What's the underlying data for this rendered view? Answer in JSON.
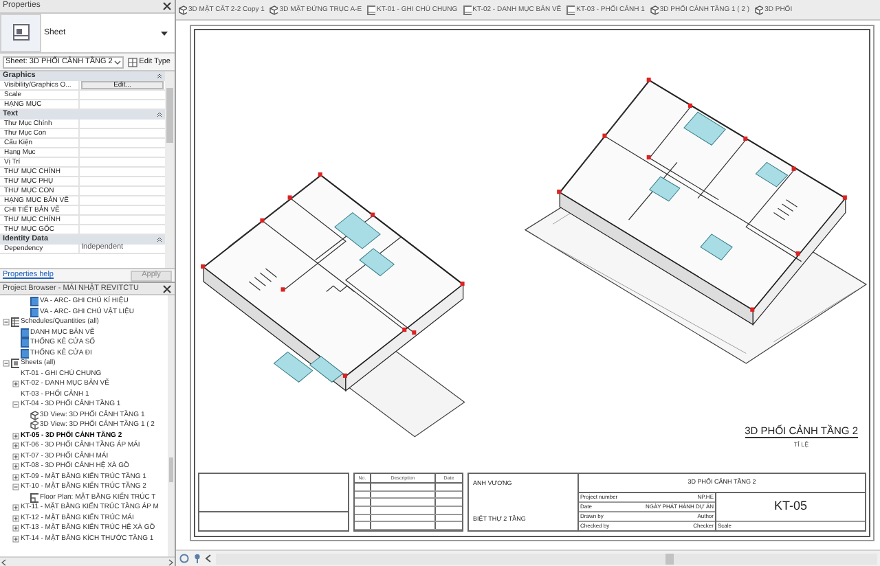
{
  "properties": {
    "title": "Properties",
    "type_name": "Sheet",
    "instance_selector": "Sheet: 3D PHỐI CẢNH TẦNG 2",
    "edit_type_button": "Edit Type",
    "groups": [
      {
        "name": "Graphics",
        "rows": [
          {
            "label": "Visibility/Graphics O...",
            "kind": "button",
            "value": "Edit..."
          },
          {
            "label": "Scale",
            "kind": "text"
          },
          {
            "label": "HẠNG MỤC",
            "kind": "text"
          }
        ]
      },
      {
        "name": "Text",
        "rows": [
          {
            "label": "Thư Mục Chính",
            "kind": "text"
          },
          {
            "label": "Thư Mục Con",
            "kind": "text"
          },
          {
            "label": "Cấu Kiện",
            "kind": "text"
          },
          {
            "label": "Hạng Mục",
            "kind": "text"
          },
          {
            "label": "Vị Trí",
            "kind": "text"
          },
          {
            "label": "THƯ MỤC CHÍNH",
            "kind": "text"
          },
          {
            "label": "THƯ MỤC PHỤ",
            "kind": "text"
          },
          {
            "label": "THƯ MỤC CON",
            "kind": "text"
          },
          {
            "label": "HẠNG MỤC BẢN VẼ",
            "kind": "text"
          },
          {
            "label": "CHI TIẾT BẢN VẼ",
            "kind": "text"
          },
          {
            "label": "THƯ MỤC CHÍNH",
            "kind": "text"
          },
          {
            "label": "THƯ MỤC GỐC",
            "kind": "text"
          }
        ]
      },
      {
        "name": "Identity Data",
        "rows": [
          {
            "label": "Dependency",
            "kind": "text",
            "value": "Independent"
          }
        ]
      }
    ],
    "help_link": "Properties help",
    "apply_button": {
      "label": "Apply",
      "disabled": true
    }
  },
  "project_browser": {
    "title": "Project Browser - MÁI NHẬT REVITCTU",
    "tree": [
      {
        "label": "VA - ARC- GHI CHÚ KÍ HIỆU",
        "kind": "legend",
        "selected": false
      },
      {
        "label": "VA - ARC- GHI CHÚ VẬT LIỆU",
        "kind": "legend",
        "selected": false
      },
      {
        "label": "Schedules/Quantities (all)",
        "kind": "schedules",
        "expanded": true,
        "selected": false,
        "children": [
          {
            "label": "DANH MỤC BẢN VẼ",
            "kind": "schedule",
            "selected": false
          },
          {
            "label": "THỐNG KÊ CỬA SỔ",
            "kind": "schedule",
            "selected": false
          },
          {
            "label": "THỐNG KÊ CỬA ĐI",
            "kind": "schedule",
            "selected": false
          }
        ]
      },
      {
        "label": "Sheets (all)",
        "kind": "sheets",
        "expanded": true,
        "selected": false,
        "children": [
          {
            "label": "KT-01 - GHI CHÚ CHUNG",
            "kind": "sheet",
            "selected": false
          },
          {
            "label": "KT-02 - DANH MỤC BẢN VẼ",
            "kind": "sheet",
            "expanded": false,
            "selected": false
          },
          {
            "label": "KT-03 - PHỐI CẢNH 1",
            "kind": "sheet",
            "selected": false
          },
          {
            "label": "KT-04 - 3D PHỐI CẢNH TẦNG 1",
            "kind": "sheet",
            "expanded": true,
            "selected": false,
            "children": [
              {
                "label": "3D View: 3D PHỐI CẢNH TẦNG 1",
                "kind": "view3d",
                "selected": false
              },
              {
                "label": "3D View: 3D PHỐI CẢNH TẦNG 1 ( 2",
                "kind": "view3d",
                "selected": false
              }
            ]
          },
          {
            "label": "KT-05 - 3D PHỐI CẢNH TẦNG 2",
            "kind": "sheet",
            "expanded": false,
            "selected": true
          },
          {
            "label": "KT-06 - 3D PHỐI CẢNH TẦNG ÁP MÁI",
            "kind": "sheet",
            "expanded": false,
            "selected": false
          },
          {
            "label": "KT-07 - 3D PHỐI CẢNH MÁI",
            "kind": "sheet",
            "expanded": false,
            "selected": false
          },
          {
            "label": "KT-08 - 3D PHỐI CẢNH HỆ XÀ GỒ",
            "kind": "sheet",
            "expanded": false,
            "selected": false
          },
          {
            "label": "KT-09 - MẶT BẰNG KIẾN TRÚC TẦNG 1",
            "kind": "sheet",
            "expanded": false,
            "selected": false
          },
          {
            "label": "KT-10 - MẶT BẰNG KIẾN TRÚC TẦNG 2",
            "kind": "sheet",
            "expanded": true,
            "selected": false,
            "children": [
              {
                "label": "Floor Plan: MẶT BẰNG KIẾN TRÚC T",
                "kind": "plan",
                "selected": false
              }
            ]
          },
          {
            "label": "KT-11 - MẶT BẰNG KIẾN TRÚC TẦNG ÁP M",
            "kind": "sheet",
            "expanded": false,
            "selected": false
          },
          {
            "label": "KT-12 - MẶT BẰNG KIẾN TRÚC MÁI",
            "kind": "sheet",
            "expanded": false,
            "selected": false
          },
          {
            "label": "KT-13 - MẶT BẰNG KIẾN TRÚC HỆ XÀ GỒ",
            "kind": "sheet",
            "expanded": false,
            "selected": false
          },
          {
            "label": "KT-14 - MẶT BẰNG KÍCH THƯỚC TẦNG 1",
            "kind": "sheet",
            "expanded": false,
            "selected": false
          }
        ]
      }
    ]
  },
  "tabs": [
    {
      "label": "3D MẶT CẮT 2-2 Copy 1",
      "kind": "view3d",
      "selected": false
    },
    {
      "label": "3D MẶT ĐỨNG TRỤC A-E",
      "kind": "view3d",
      "selected": false
    },
    {
      "label": "KT-01 - GHI CHÚ CHUNG",
      "kind": "sheet",
      "selected": false
    },
    {
      "label": "KT-02 - DANH MỤC BẢN VẼ",
      "kind": "sheet",
      "selected": false
    },
    {
      "label": "KT-03 - PHỐI CẢNH 1",
      "kind": "sheet",
      "selected": false
    },
    {
      "label": "3D PHỐI CẢNH TẦNG 1 ( 2 )",
      "kind": "view3d",
      "selected": false
    },
    {
      "label": "3D PHỐI",
      "kind": "view3d",
      "selected": false
    }
  ],
  "sheet": {
    "view_title": "3D PHỐI CẢNH TẦNG 2",
    "view_scale_label": "TỈ LỆ",
    "title_block": {
      "revision_headers": [
        "No.",
        "Description",
        "Date"
      ],
      "owner": "ANH VƯƠNG",
      "project_name": "BIỆT THỰ 2 TẦNG",
      "sheet_name": "3D PHỐI CẢNH TẦNG 2",
      "fields": [
        {
          "label": "Project number",
          "value": "NP.HE"
        },
        {
          "label": "Date",
          "value": "NGÀY PHÁT HÀNH DỰ ÁN"
        },
        {
          "label": "Drawn by",
          "value": "Author"
        },
        {
          "label": "Checked by",
          "value": "Checker"
        }
      ],
      "scale_label": "Scale",
      "sheet_number": "KT-05"
    }
  }
}
